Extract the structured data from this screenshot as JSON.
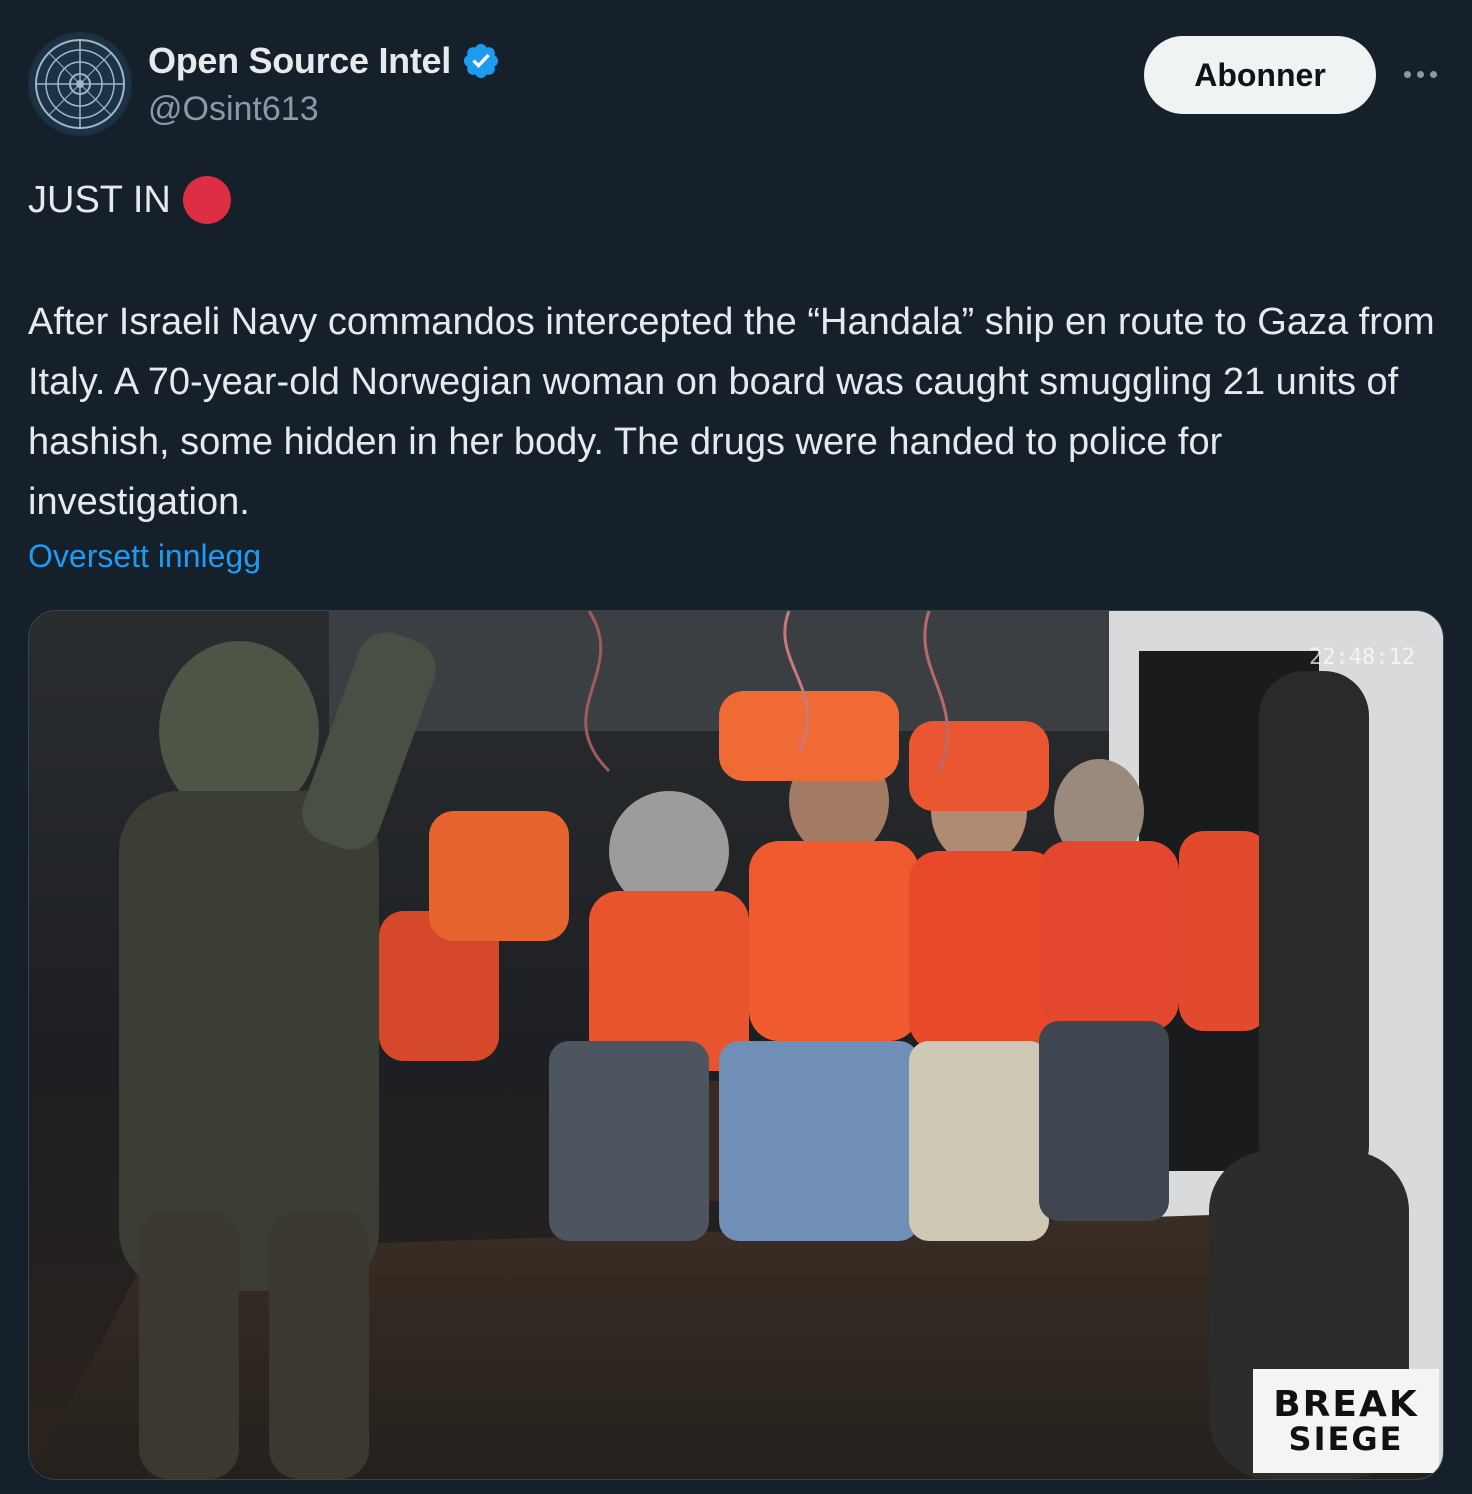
{
  "author": {
    "display_name": "Open Source Intel",
    "handle": "@Osint613",
    "verified": true,
    "avatar_icon": "compass-seal-icon"
  },
  "actions": {
    "follow_label": "Abonner",
    "more_icon": "more-horizontal-icon"
  },
  "tweet": {
    "headline": "JUST IN",
    "headline_emoji": "red-circle-icon",
    "body": "After Israeli Navy commandos intercepted the “Handala” ship en route to Gaza from Italy. A 70-year-old Norwegian woman on board was caught smuggling 21 units of hashish, some hidden in her body. The drugs were handed to police for investigation.",
    "translate_label": "Oversett innlegg"
  },
  "media": {
    "timestamp_text": "22:48:12",
    "watermark_line1": "BREAK",
    "watermark_line2": "SIEGE"
  },
  "colors": {
    "background": "#15202b",
    "text_primary": "#e7e9ea",
    "text_secondary": "#8b98a5",
    "link": "#1d9bf0",
    "verified": "#1d9bf0",
    "red_circle": "#dd2e44",
    "button_bg": "#eff3f4"
  }
}
